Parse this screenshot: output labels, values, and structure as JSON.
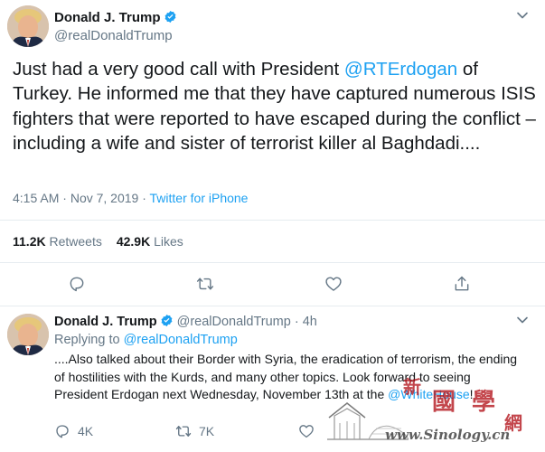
{
  "main_tweet": {
    "author_name": "Donald J. Trump",
    "author_handle": "@realDonaldTrump",
    "text_before": "Just had a very good call with President ",
    "mention": "@RTErdogan",
    "text_after": " of Turkey. He informed me that they have captured numerous ISIS fighters that were reported to have escaped during the conflict – including a wife and sister of terrorist killer al Baghdadi....",
    "time": "4:15 AM",
    "separator": " · ",
    "date": "Nov 7, 2019",
    "source": "Twitter for iPhone",
    "retweets_count": "11.2K",
    "retweets_label": " Retweets",
    "likes_count": "42.9K",
    "likes_label": " Likes"
  },
  "reply_tweet": {
    "author_name": "Donald J. Trump",
    "author_handle": "@realDonaldTrump",
    "dot": " · ",
    "age": "4h",
    "replying_label": "Replying to ",
    "replying_to": "@realDonaldTrump",
    "text": "....Also talked about their Border with Syria, the eradication of terrorism, the ending of hostilities with the Kurds, and many other topics. Look forward to seeing President Erdogan next Wednesday, November 13th at the ",
    "text_mention": "@WhiteHouse",
    "text_end": "!",
    "reply_count": "4K",
    "retweet_count": "7K"
  },
  "watermark": {
    "chars": [
      "新",
      "國",
      "學",
      "網"
    ],
    "url": "www.Sinology.cn"
  },
  "icons": {
    "verified": "verified-badge-icon",
    "caret": "chevron-down-icon",
    "reply": "reply-icon",
    "retweet": "retweet-icon",
    "like": "heart-icon",
    "share": "share-icon"
  },
  "colors": {
    "accent": "#1da1f2",
    "text": "#14171a",
    "muted": "#657786",
    "divider": "#e6ecf0",
    "watermark_red": "#b3131b"
  }
}
